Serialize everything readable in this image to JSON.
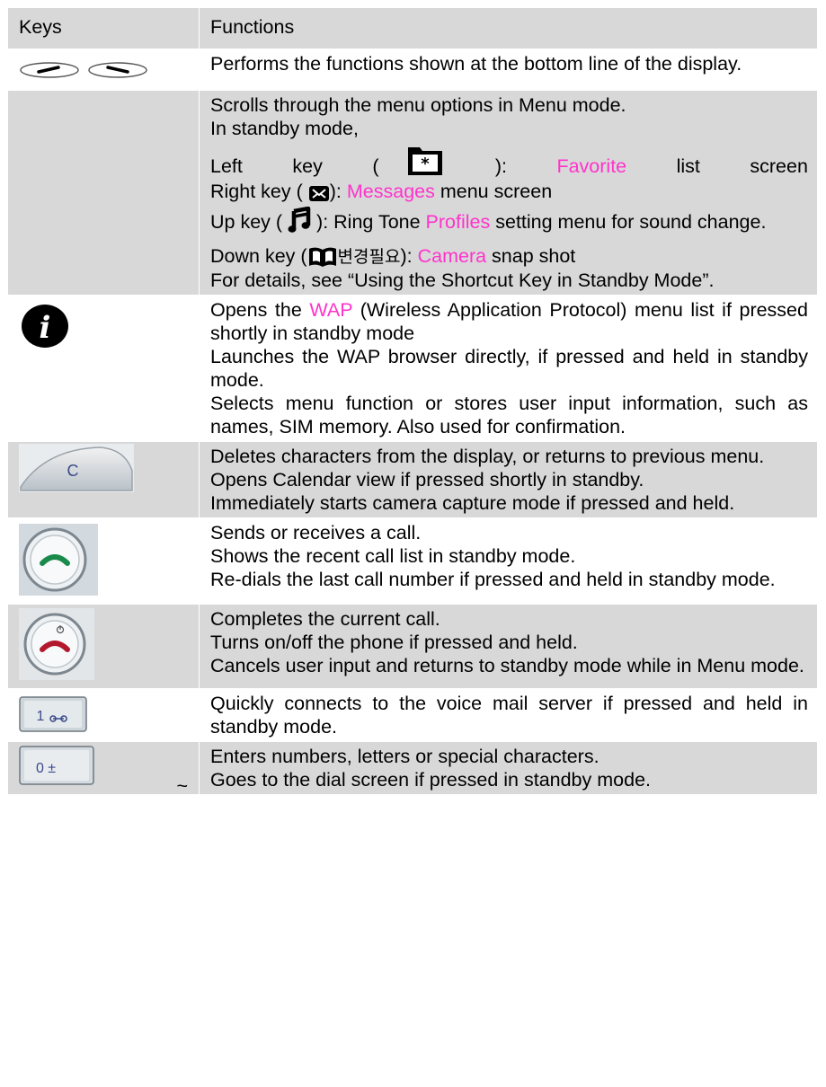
{
  "table": {
    "header": {
      "keys": "Keys",
      "functions": "Functions"
    },
    "rows": [
      {
        "key_icon": "soft-keys-icon",
        "lines": [
          "Performs the functions shown at the bottom line of the display."
        ]
      },
      {
        "key_icon": "",
        "line1": "Scrolls through the menu options in Menu mode.",
        "line2": "In standby mode,",
        "left": {
          "a": "Left",
          "b": "key",
          "c": "(",
          "d": "):",
          "pink": "Favorite",
          "e": "list",
          "f": "screen",
          "icon": "favorite-folder-icon"
        },
        "right": {
          "pre": "Right key (",
          "post": "):",
          "pink": "Messages",
          "rest": "menu screen",
          "icon": "envelope-icon"
        },
        "up": {
          "pre": "Up key (",
          "post": "): Ring Tone",
          "pink": "Profiles",
          "rest": "setting menu for sound change.",
          "icon": "music-note-icon"
        },
        "down": {
          "pre": "Down key (",
          "kr": "변경필요",
          "post": "):",
          "pink": "Camera",
          "rest": "snap shot",
          "icon": "book-icon"
        },
        "line_last": "For details, see “Using the Shortcut Key in Standby Mode”."
      },
      {
        "key_icon": "info-key-icon",
        "pre": "Opens the",
        "pink": "WAP",
        "post": "(Wireless Application Protocol) menu list if pressed shortly in standby mode",
        "lines": [
          "Launches the WAP browser directly, if pressed and held in standby mode.",
          "Selects menu function or stores user input information, such as names, SIM memory. Also used for confirmation."
        ]
      },
      {
        "key_icon": "clear-key-icon",
        "key_label": "C",
        "lines": [
          "Deletes characters from the display, or returns to previous menu.",
          "Opens Calendar view if pressed shortly in standby.",
          "Immediately starts camera capture mode if pressed and held."
        ]
      },
      {
        "key_icon": "send-key-icon",
        "lines": [
          "Sends or receives a call.",
          "Shows the recent call list in standby mode.",
          "Re-dials the last call number if pressed and held in standby mode."
        ]
      },
      {
        "key_icon": "end-key-icon",
        "lines": [
          "Completes the current call.",
          "Turns on/off the phone if pressed and held.",
          "Cancels user input and returns to standby mode while in Menu mode."
        ]
      },
      {
        "key_icon": "one-key-icon",
        "key_label": "1",
        "lines": [
          "Quickly connects to the voice mail server if pressed and held in standby mode."
        ]
      },
      {
        "key_icon": "zero-key-icon",
        "key_label": "0 ±",
        "tilde": "~",
        "lines": [
          "Enters numbers, letters or special characters.",
          "Goes to the dial screen if pressed in standby mode."
        ]
      }
    ]
  }
}
